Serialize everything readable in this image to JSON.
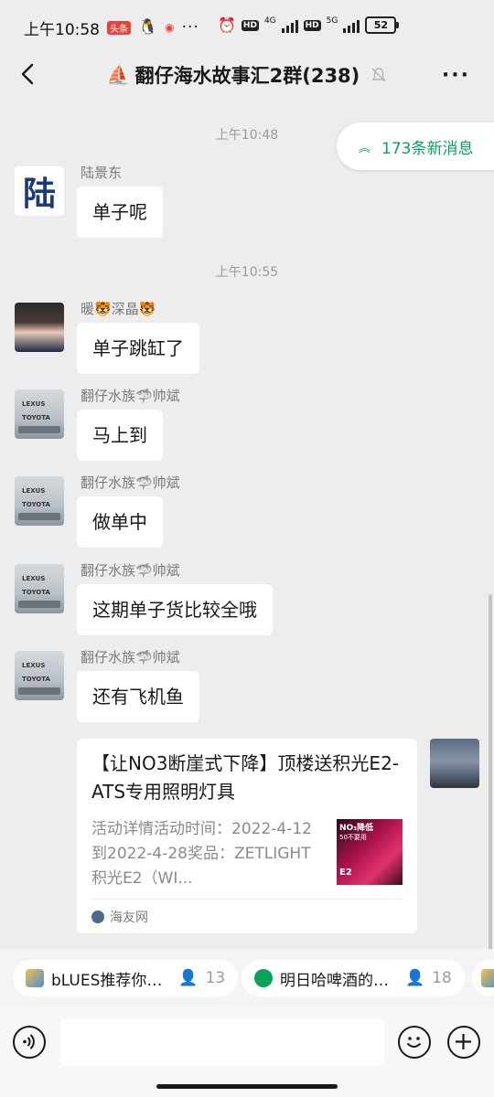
{
  "status": {
    "time": "上午10:58",
    "badge": "头条",
    "network_4g": "4G",
    "network_5g": "5G",
    "hd": "HD",
    "battery": "52"
  },
  "header": {
    "title": "翻仔海水故事汇2群(238)",
    "boat_icon": "⛵",
    "back_icon": "back-arrow-icon",
    "mute_icon": "bell-off-icon",
    "more_label": "···"
  },
  "new_messages": {
    "label": "173条新消息"
  },
  "timestamps": [
    "上午10:48",
    "上午10:55"
  ],
  "messages": [
    {
      "sender": "陆景东",
      "text": "单子呢",
      "avatar_char": "陆"
    },
    {
      "sender": "暖🐯深晶🐯",
      "text": "单子跳缸了"
    },
    {
      "sender": "翻仔水族🦈帅斌",
      "text": "马上到"
    },
    {
      "sender": "翻仔水族🦈帅斌",
      "text": "做单中"
    },
    {
      "sender": "翻仔水族🦈帅斌",
      "text": "这期单子货比较全哦"
    },
    {
      "sender": "翻仔水族🦈帅斌",
      "text": "还有飞机鱼"
    }
  ],
  "avatar_lexus": {
    "line1": "LEXUS",
    "line2": "TOYOTA"
  },
  "link_card": {
    "title": "【让NO3断崖式下降】顶楼送积光E2-ATS专用照明灯具",
    "description": "活动详情活动时间：2022-4-12到2022-4-28奖品：ZETLIGHT积光E2（WI...",
    "thumb_line1": "NO₃降低",
    "thumb_line2": "50不要用",
    "thumb_label": "E2",
    "source": "海友网"
  },
  "topics": [
    {
      "label": "bLUES推荐你…",
      "count": "13"
    },
    {
      "label": "明日哈啤酒的…",
      "count": "18"
    }
  ],
  "input": {
    "placeholder": "",
    "voice_icon": "voice-icon",
    "emoji_icon": "emoji-icon",
    "plus_icon": "plus-icon"
  },
  "colors": {
    "accent_green": "#07a35a",
    "background": "#ededed"
  }
}
